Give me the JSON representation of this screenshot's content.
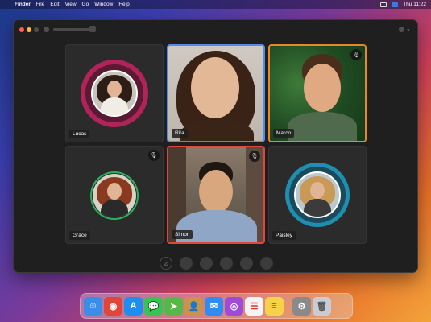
{
  "menubar": {
    "apple": "",
    "items": [
      "Finder",
      "File",
      "Edit",
      "View",
      "Go",
      "Window",
      "Help"
    ],
    "clock": "Thu 11:22"
  },
  "participants": [
    {
      "name": "Lucas",
      "ring_color": "#c0245e",
      "muted": false
    },
    {
      "name": "Rita",
      "border": "#4f8de8",
      "muted": false
    },
    {
      "name": "Marco",
      "border": "#e8862a",
      "muted": true
    },
    {
      "name": "Grace",
      "ring_color": "#27b35a",
      "muted": true
    },
    {
      "name": "Simon",
      "border": "#e0473a",
      "muted": true
    },
    {
      "name": "Paisley",
      "ring_color": "#1f8fb0",
      "muted": false
    }
  ],
  "controls": {
    "first_icon": "⊘"
  },
  "dock": {
    "icons": [
      {
        "name": "finder",
        "glyph": "☺",
        "color": "#3a8ee8"
      },
      {
        "name": "chrome",
        "glyph": "◉",
        "color": "#e0453a"
      },
      {
        "name": "app-store",
        "glyph": "A",
        "color": "#1f8ef0"
      },
      {
        "name": "messages",
        "glyph": "💬",
        "color": "#33c650"
      },
      {
        "name": "maps",
        "glyph": "➤",
        "color": "#57b84a"
      },
      {
        "name": "contacts",
        "glyph": "👤",
        "color": "#c9944a"
      },
      {
        "name": "mail",
        "glyph": "✉",
        "color": "#2f8cf0"
      },
      {
        "name": "podcasts",
        "glyph": "◎",
        "color": "#a04ad8"
      },
      {
        "name": "reminders",
        "glyph": "☰",
        "color": "#f4f4f4"
      },
      {
        "name": "notes",
        "glyph": "≡",
        "color": "#f5d24a"
      },
      {
        "name": "system-preferences",
        "glyph": "⚙",
        "color": "#8a8a8a"
      },
      {
        "name": "trash",
        "glyph": "🗑",
        "color": "#c9ccd4"
      }
    ]
  }
}
